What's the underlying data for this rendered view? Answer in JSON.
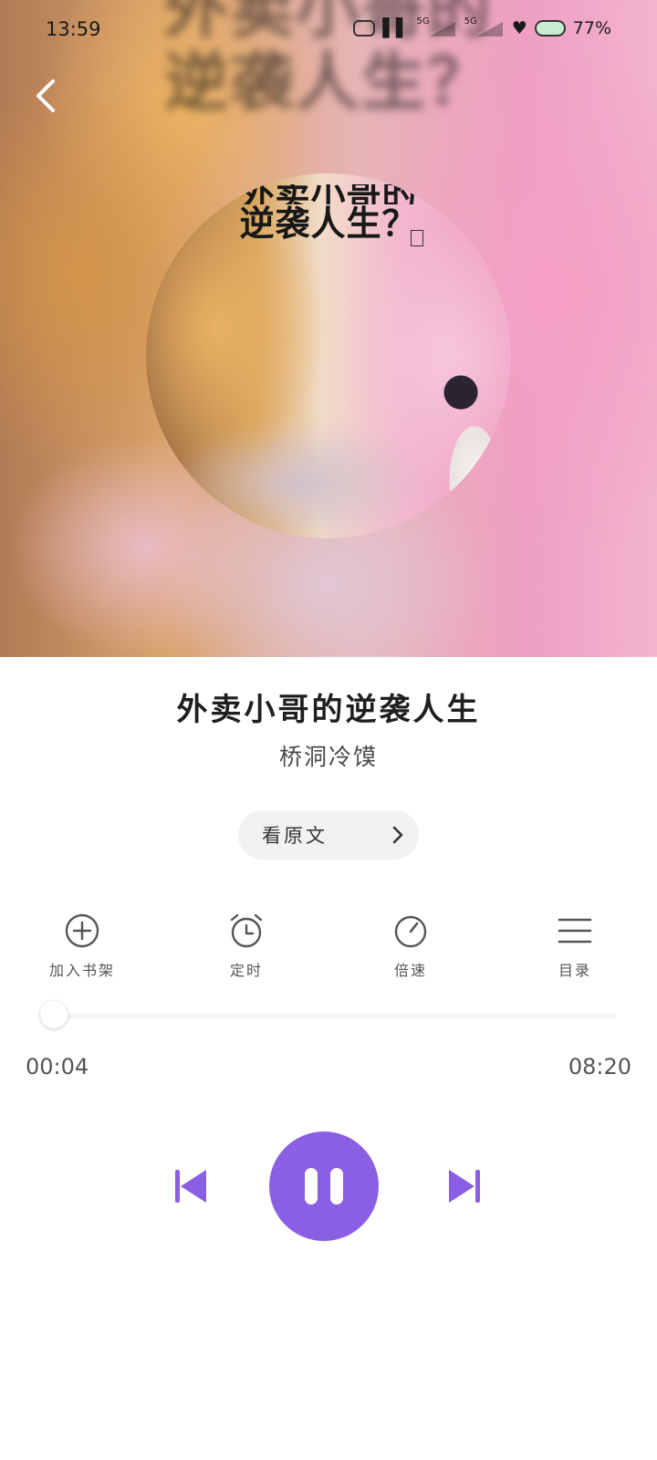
{
  "status_bar": {
    "time": "13:59",
    "network_1": "5G",
    "network_2": "5G",
    "battery": "77%"
  },
  "hero": {
    "back_icon": "chevron-left-icon",
    "blurred_cover_text_1": "外卖小哥的",
    "blurred_cover_text_2": "逆袭人生？",
    "cover_text_partial": "外卖小哥的",
    "cover_text_line2": "逆袭人生？"
  },
  "book": {
    "title": "外卖小哥的逆袭人生",
    "author": "桥洞冷馍"
  },
  "read_original": {
    "label": "看原文",
    "icon": "chevron-right-icon"
  },
  "toolbar": {
    "items": [
      {
        "label": "加入书架",
        "icon": "plus-circle-icon"
      },
      {
        "label": "定时",
        "icon": "alarm-clock-icon"
      },
      {
        "label": "倍速",
        "icon": "speed-gauge-icon"
      },
      {
        "label": "目录",
        "icon": "menu-list-icon"
      }
    ]
  },
  "player": {
    "current_time": "00:04",
    "total_time": "08:20",
    "progress_fraction": 0.008,
    "accent_color": "#8b5fe3",
    "prev_icon": "skip-previous-icon",
    "pause_icon": "pause-icon",
    "next_icon": "skip-next-icon"
  }
}
